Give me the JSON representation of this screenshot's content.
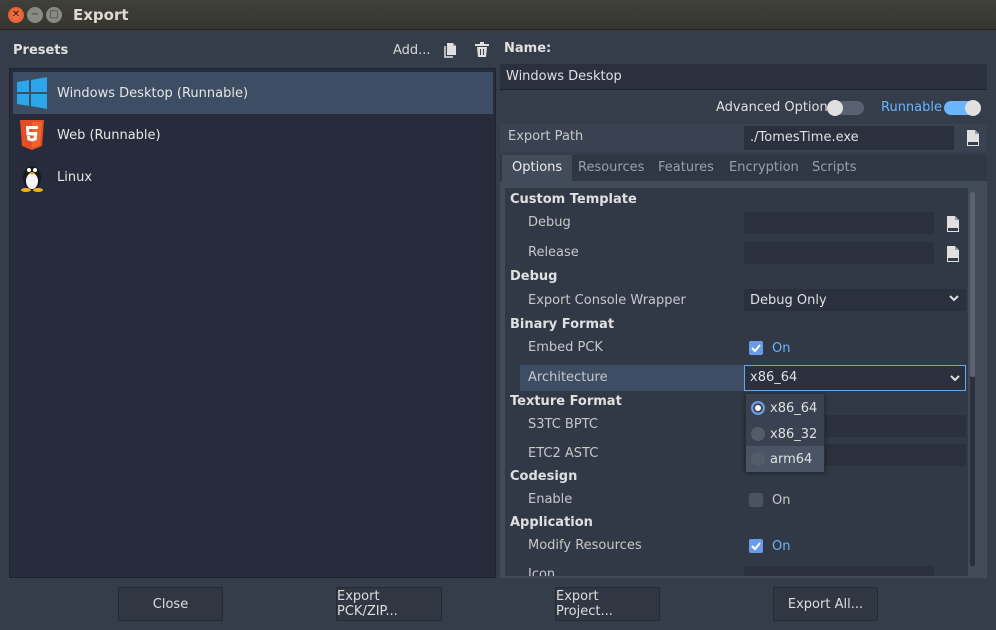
{
  "window": {
    "title": "Export"
  },
  "presets": {
    "title": "Presets",
    "add_label": "Add...",
    "items": [
      {
        "label": "Windows Desktop (Runnable)",
        "icon": "windows-icon",
        "selected": true
      },
      {
        "label": "Web (Runnable)",
        "icon": "html5-icon",
        "selected": false
      },
      {
        "label": "Linux",
        "icon": "linux-tux-icon",
        "selected": false
      }
    ]
  },
  "details": {
    "name_label": "Name:",
    "name_value": "Windows Desktop",
    "advanced_label": "Advanced Options",
    "advanced_on": false,
    "runnable_label": "Runnable",
    "runnable_on": true,
    "export_path_label": "Export Path",
    "export_path_value": "./TomesTime.exe"
  },
  "tabs": [
    "Options",
    "Resources",
    "Features",
    "Encryption",
    "Scripts"
  ],
  "options": {
    "custom_template": {
      "section": "Custom Template",
      "debug_label": "Debug",
      "release_label": "Release"
    },
    "debug": {
      "section": "Debug",
      "console_label": "Export Console Wrapper",
      "console_value": "Debug Only"
    },
    "binary_format": {
      "section": "Binary Format",
      "embed_label": "Embed PCK",
      "embed_value": "On",
      "arch_label": "Architecture",
      "arch_value": "x86_64"
    },
    "texture_format": {
      "section": "Texture Format",
      "s3tc_label": "S3TC BPTC",
      "etc2_label": "ETC2 ASTC"
    },
    "codesign": {
      "section": "Codesign",
      "enable_label": "Enable",
      "enable_value": "On"
    },
    "application": {
      "section": "Application",
      "modify_label": "Modify Resources",
      "modify_value": "On",
      "icon_label": "Icon"
    }
  },
  "arch_dropdown": {
    "options": [
      "x86_64",
      "x86_32",
      "arm64"
    ],
    "selected": "x86_64"
  },
  "buttons": {
    "close": "Close",
    "export_pck": "Export PCK/ZIP...",
    "export_project": "Export Project...",
    "export_all": "Export All..."
  },
  "colors": {
    "accent": "#6bb4ff",
    "checkbox": "#699ce8",
    "selected_row": "#3d4d63",
    "background": "#363d4a"
  }
}
